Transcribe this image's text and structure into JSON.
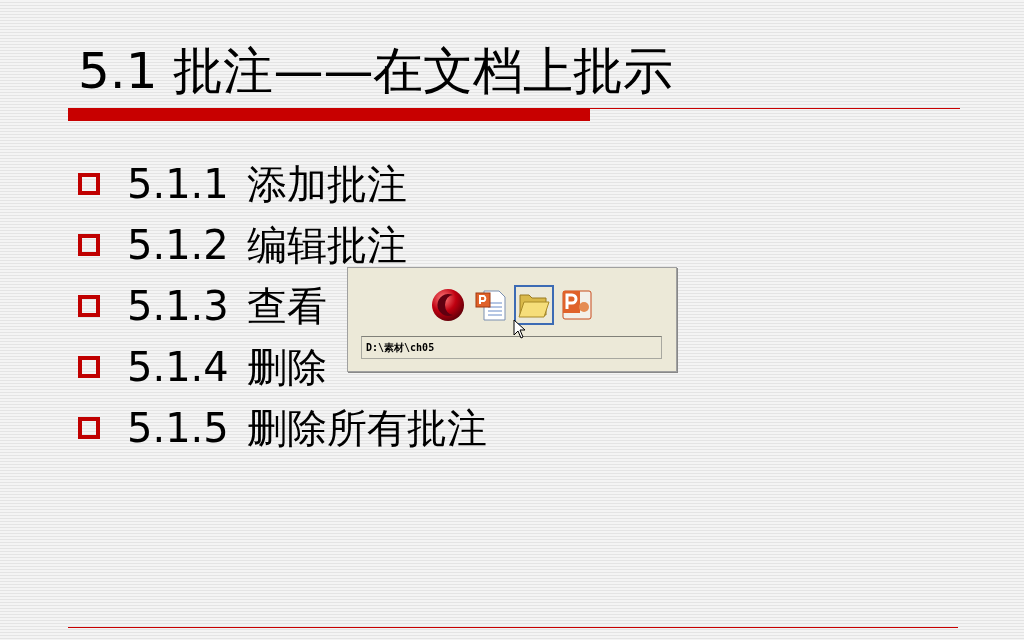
{
  "slide": {
    "title": "5.1  批注——在文档上批示",
    "items": [
      {
        "number": "5.1.1",
        "text": "添加批注"
      },
      {
        "number": "5.1.2",
        "text": "编辑批注"
      },
      {
        "number": "5.1.3",
        "text": "查看"
      },
      {
        "number": "5.1.4",
        "text": "删除"
      },
      {
        "number": "5.1.5",
        "text": "删除所有批注"
      }
    ]
  },
  "task_switcher": {
    "apps": [
      {
        "kind": "orb",
        "selected": false
      },
      {
        "kind": "document",
        "selected": false
      },
      {
        "kind": "folder",
        "selected": true
      },
      {
        "kind": "presentation",
        "selected": false
      }
    ],
    "path": "D:\\素材\\ch05"
  }
}
